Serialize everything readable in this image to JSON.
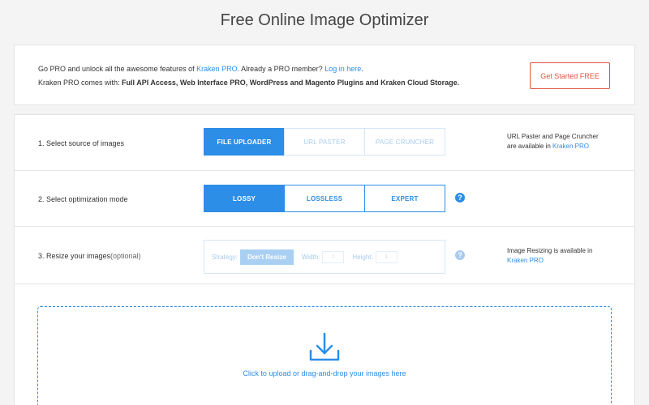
{
  "page": {
    "title": "Free Online Image Optimizer"
  },
  "promo": {
    "line1_prefix": "Go PRO and unlock all the awesome features of ",
    "line1_link": "Kraken PRO",
    "line1_middle": ". Already a PRO member? ",
    "line1_login": "Log in here",
    "line1_end": ".",
    "line2_prefix": "Kraken PRO comes with: ",
    "line2_bold": "Full API Access, Web Interface PRO, WordPress and Magento Plugins and Kraken Cloud Storage.",
    "cta": "Get Started FREE"
  },
  "source": {
    "label": "1. Select source of images",
    "options": [
      "FILE UPLOADER",
      "URL PASTER",
      "PAGE CRUNCHER"
    ],
    "selected": "FILE UPLOADER",
    "note_line1": "URL Paster and Page Cruncher",
    "note_line2_prefix": "are available in ",
    "note_link": "Kraken PRO"
  },
  "mode": {
    "label": "2. Select optimization mode",
    "options": [
      "LOSSY",
      "LOSSLESS",
      "EXPERT"
    ],
    "selected": "LOSSY",
    "help": "?"
  },
  "resize": {
    "label": "3. Resize your images",
    "label_optional": " (optional)",
    "strategy_label": "Strategy:",
    "strategy_value": "Don't Resize",
    "width_label": "Width:",
    "width_value": "1",
    "height_label": "Height:",
    "height_value": "1",
    "help": "?",
    "note_line1": "Image Resizing is available in",
    "note_link": "Kraken PRO"
  },
  "upload": {
    "text": "Click to upload or drag-and-drop your images here"
  },
  "colors": {
    "accent": "#2d8ee8",
    "cta": "#e35340",
    "disabled": "#a9cbef"
  }
}
